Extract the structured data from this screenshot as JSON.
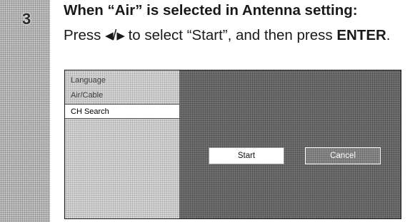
{
  "step": {
    "number": "3"
  },
  "heading": "When “Air” is selected in Antenna setting:",
  "instruction": {
    "press": "Press",
    "left_arrow": "◀",
    "slash": "/",
    "right_arrow": "▶",
    "middle": "to select “Start”, and then press",
    "enter": "ENTER",
    "period": "."
  },
  "screen": {
    "menu_items": [
      {
        "label": "Language",
        "selected": false
      },
      {
        "label": "Air/Cable",
        "selected": false
      },
      {
        "label": "CH Search",
        "selected": true
      }
    ],
    "buttons": {
      "start": "Start",
      "cancel": "Cancel"
    }
  },
  "colors": {
    "sidebar_pattern": "#c4c4c4",
    "screen_background": "#727272",
    "menu_background": "#d4d4d4",
    "selected_item": "#ffffff",
    "start_button": "#ffffff",
    "cancel_button": "#8c8c8c"
  }
}
